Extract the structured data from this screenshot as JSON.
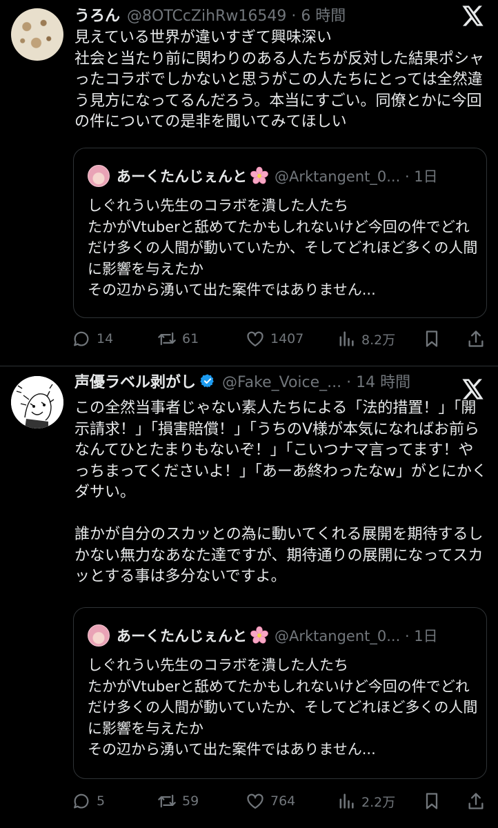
{
  "tweets": [
    {
      "author": {
        "name": "うろん",
        "handle": "@8OTCcZihRw16549",
        "time": "6 時間"
      },
      "text": "見えている世界が違いすぎて興味深い\n社会と当たり前に関わりのある人たちが反対した結果ポシャったコラボでしかないと思うがこの人たちにとっては全然違う見方になってるんだろう。本当にすごい。同僚とかに今回の件についての是非を聞いてみてほしい",
      "quote": {
        "name": "あーくたんじぇんと",
        "handle": "@Arktangent_0...",
        "time": "1日",
        "text": "しぐれうい先生のコラボを潰した人たち\nたかがVtuberと舐めてたかもしれないけど今回の件でどれだけ多くの人間が動いていたか、そしてどれほど多くの人間に影響を与えたか\nその辺から湧いて出た案件ではありません..."
      },
      "stats": {
        "replies": "14",
        "reposts": "61",
        "likes": "1407",
        "views": "8.2万"
      }
    },
    {
      "author": {
        "name": "声優ラベル剥がし",
        "handle": "@Fake_Voice_...",
        "time": "14 時間"
      },
      "text": "この全然当事者じゃない素人たちによる「法的措置！」「開示請求！」「損害賠償！」「うちのV様が本気になればお前らなんてひとたまりもないぞ！」「こいつナマ言ってます！やっちまってくださいよ！」「あーあ終わったなw」がとにかくダサい。\n\n誰かが自分のスカッとの為に動いてくれる展開を期待するしかない無力なあなた達ですが、期待通りの展開になってスカッとする事は多分ないですよ。",
      "quote": {
        "name": "あーくたんじぇんと",
        "handle": "@Arktangent_0...",
        "time": "1日",
        "text": "しぐれうい先生のコラボを潰した人たち\nたかがVtuberと舐めてたかもしれないけど今回の件でどれだけ多くの人間が動いていたか、そしてどれほど多くの人間に影響を与えたか\nその辺から湧いて出た案件ではありません..."
      },
      "stats": {
        "replies": "5",
        "reposts": "59",
        "likes": "764",
        "views": "2.2万"
      }
    }
  ],
  "icons": {
    "brand": "x-logo-icon",
    "verified": "verified-badge-icon",
    "reply": "reply-icon",
    "repost": "repost-icon",
    "like": "heart-icon",
    "views": "views-icon",
    "bookmark": "bookmark-icon",
    "share": "share-icon"
  },
  "colors": {
    "background": "#000000",
    "text": "#e7e9ea",
    "muted": "#71767b",
    "border": "#2f3336",
    "verified": "#1d9bf0"
  }
}
